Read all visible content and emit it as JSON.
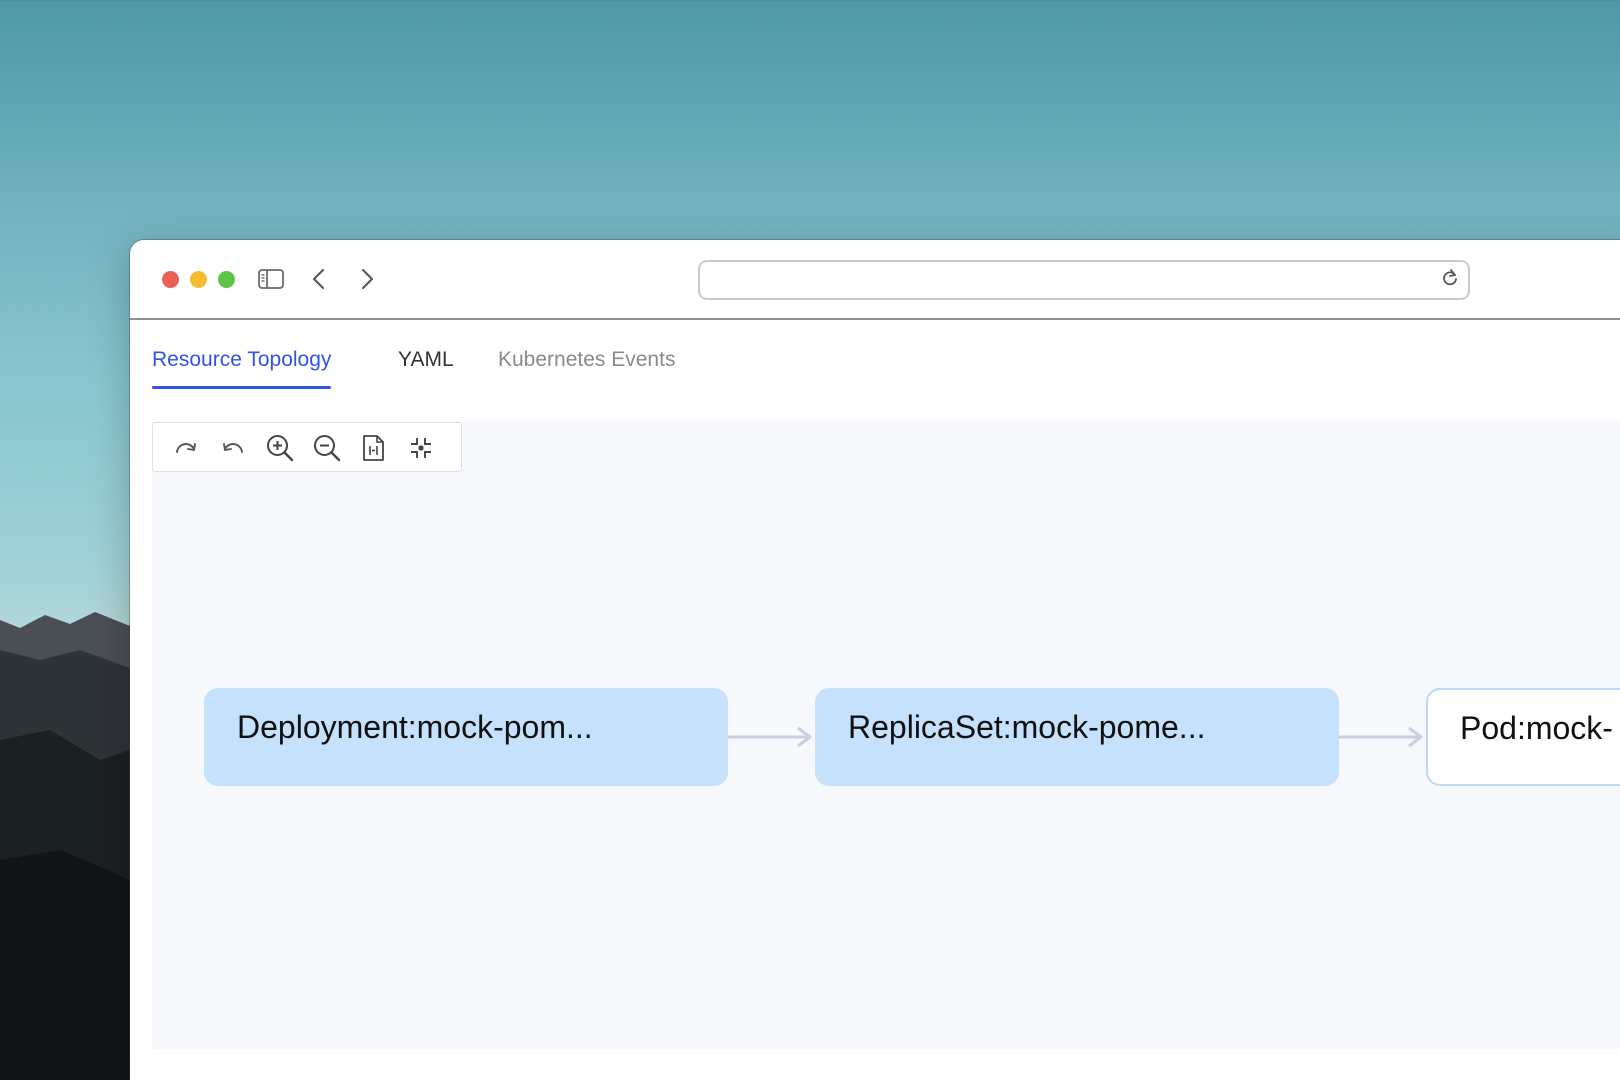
{
  "browser": {
    "address_value": ""
  },
  "tabs": [
    {
      "label": "Resource Topology",
      "active": true
    },
    {
      "label": "YAML",
      "active": false
    },
    {
      "label": "Kubernetes Events",
      "active": false
    }
  ],
  "toolbar": {
    "tools": [
      "redo-icon",
      "undo-icon",
      "zoom-in-icon",
      "zoom-out-icon",
      "fit-page-icon",
      "focus-center-icon"
    ]
  },
  "topology": {
    "nodes": [
      {
        "label": "Deployment:mock-pom...",
        "kind": "Deployment"
      },
      {
        "label": "ReplicaSet:mock-pome...",
        "kind": "ReplicaSet"
      },
      {
        "label": "Pod:mock-",
        "kind": "Pod"
      }
    ],
    "edge_color": "#c8cfdf",
    "node_fill": "#c5e1fb"
  },
  "colors": {
    "accent": "#2f56e0",
    "tab_inactive": "#8a8a8a"
  }
}
